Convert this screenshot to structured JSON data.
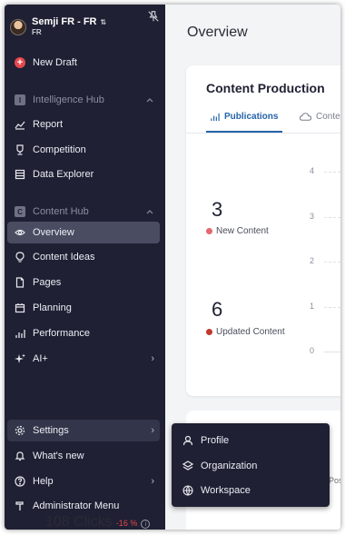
{
  "user": {
    "name": "Semji FR - FR",
    "subtitle": "FR"
  },
  "new_draft": "New Draft",
  "sections": {
    "intelligence": {
      "badge": "I",
      "label": "Intelligence Hub"
    },
    "content": {
      "badge": "C",
      "label": "Content Hub"
    }
  },
  "nav": {
    "report": "Report",
    "competition": "Competition",
    "data_explorer": "Data Explorer",
    "overview": "Overview",
    "content_ideas": "Content Ideas",
    "pages": "Pages",
    "planning": "Planning",
    "performance": "Performance",
    "ai_plus": "AI+",
    "settings": "Settings",
    "whats_new": "What's new",
    "help": "Help",
    "admin_menu": "Administrator Menu"
  },
  "main": {
    "title": "Overview",
    "card_title": "Content Production",
    "tabs": [
      "Publications",
      "Conte"
    ],
    "stats": [
      {
        "value": "3",
        "label": "New Content",
        "color": "#e5676b"
      },
      {
        "value": "6",
        "label": "Updated Content",
        "color": "#c0392b"
      }
    ],
    "axis_ticks": [
      "4",
      "3",
      "2",
      "1",
      "0"
    ],
    "clicks": {
      "value": "108 Clicks",
      "change": "-16 %"
    },
    "partial_label": "Pos"
  },
  "settings_menu": {
    "items": [
      "Profile",
      "Organization",
      "Workspace"
    ]
  },
  "colors": {
    "sidebar_bg": "#1f2033",
    "accent": "#2563a8",
    "danger": "#e5484d"
  }
}
